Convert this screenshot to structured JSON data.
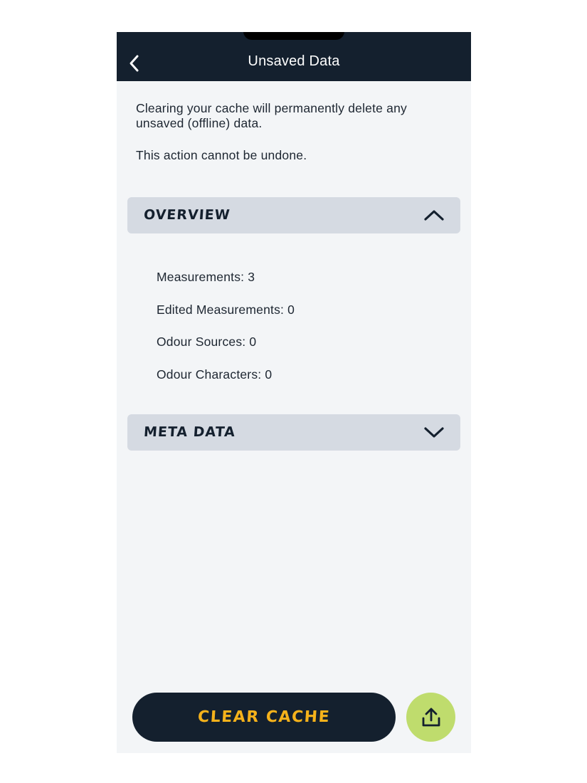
{
  "header": {
    "title": "Unsaved Data",
    "back_icon": "chevron-left-icon"
  },
  "intro": {
    "description": "Clearing your cache will permanently delete any unsaved (offline) data.",
    "warning": "This action cannot be undone."
  },
  "sections": {
    "overview": {
      "title": "OVERVIEW",
      "state": "expanded",
      "icon": "chevron-up-icon",
      "items": [
        "Measurements: 3",
        "Edited Measurements: 0",
        "Odour Sources: 0",
        "Odour Characters: 0"
      ]
    },
    "meta_data": {
      "title": "META DATA",
      "state": "collapsed",
      "icon": "chevron-down-icon"
    }
  },
  "actions": {
    "clear_cache_label": "CLEAR CACHE",
    "upload_icon": "upload-icon"
  },
  "colors": {
    "header_bg": "#14202e",
    "page_bg": "#f3f5f7",
    "section_bg": "#d5dae2",
    "accent_yellow": "#f5b21b",
    "upload_green": "#bfdc6d"
  }
}
